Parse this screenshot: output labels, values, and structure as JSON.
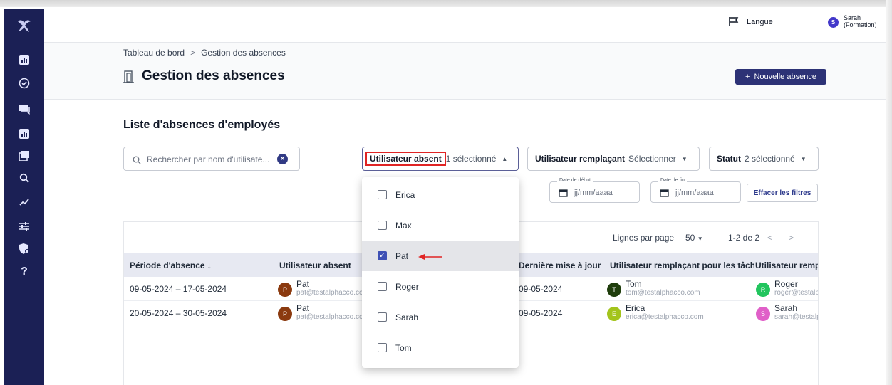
{
  "topbar": {
    "language_label": "Langue",
    "user_initial": "S",
    "user_name": "Sarah",
    "user_role": "(Formation)"
  },
  "breadcrumb": {
    "home": "Tableau de bord",
    "separator": ">",
    "current": "Gestion des absences"
  },
  "header": {
    "title": "Gestion des absences",
    "new_button": "Nouvelle absence",
    "new_button_icon": "+"
  },
  "list": {
    "title": "Liste d'absences d'employés"
  },
  "search": {
    "placeholder": "Rechercher par nom d'utilisate..."
  },
  "filters": {
    "absent_user": {
      "label": "Utilisateur absent",
      "value": "1 sélectionné"
    },
    "replacement_user": {
      "label": "Utilisateur remplaçant",
      "value": "Sélectionner"
    },
    "status": {
      "label": "Statut",
      "value": "2 sélectionné"
    },
    "start_date": {
      "label": "Date de début",
      "placeholder": "jj/mm/aaaa"
    },
    "end_date": {
      "label": "Date de fin",
      "placeholder": "jj/mm/aaaa"
    },
    "reset_button": "Effacer les filtres"
  },
  "pagination": {
    "rows_label": "Lignes par page",
    "page_size": "50",
    "range": "1-2 de 2"
  },
  "table": {
    "headers": {
      "period": "Période d'absence",
      "period_sort": "↓",
      "absent_user": "Utilisateur absent",
      "last_update": "Dernière mise à jour",
      "task_replacement": "Utilisateur remplaçant pour les tâches",
      "replacement": "Utilisateur remplaçant"
    },
    "rows": [
      {
        "period": "09-05-2024 – 17-05-2024",
        "absent_initial": "P",
        "absent_name": "Pat",
        "absent_email": "pat@testalphacco.com",
        "last_update": "09-05-2024",
        "task_initial": "T",
        "task_name": "Tom",
        "task_email": "tom@testalphacco.com",
        "repl_initial": "R",
        "repl_name": "Roger",
        "repl_email": "roger@testalphacco.com"
      },
      {
        "period": "20-05-2024 – 30-05-2024",
        "absent_initial": "P",
        "absent_name": "Pat",
        "absent_email": "pat@testalphacco.com",
        "last_update": "09-05-2024",
        "task_initial": "E",
        "task_name": "Erica",
        "task_email": "erica@testalphacco.com",
        "repl_initial": "S",
        "repl_name": "Sarah",
        "repl_email": "sarah@testalphacco.com"
      }
    ]
  },
  "dropdown": {
    "options": [
      {
        "label": "Erica",
        "checked": false
      },
      {
        "label": "Max",
        "checked": false
      },
      {
        "label": "Pat",
        "checked": true
      },
      {
        "label": "Roger",
        "checked": false
      },
      {
        "label": "Sarah",
        "checked": false
      },
      {
        "label": "Tom",
        "checked": false
      }
    ]
  },
  "colors": {
    "sidebar": "#1b2055",
    "primary": "#2d3276",
    "highlight": "#e02424",
    "avatar_pat": "#8b3a0f",
    "avatar_tom": "#1f3d0c",
    "avatar_erica": "#a3c41c",
    "avatar_roger": "#22c55e",
    "avatar_sarah": "#e05fc8"
  },
  "icons": [
    "logo-icon",
    "chart-icon",
    "check-circle-icon",
    "chat-icon",
    "bar-chart-icon",
    "cards-icon",
    "search-icon",
    "trend-icon",
    "sliders-icon",
    "shield-icon",
    "help-icon",
    "flag-icon",
    "door-icon",
    "calendar-icon",
    "close-icon",
    "arrow-icon"
  ]
}
